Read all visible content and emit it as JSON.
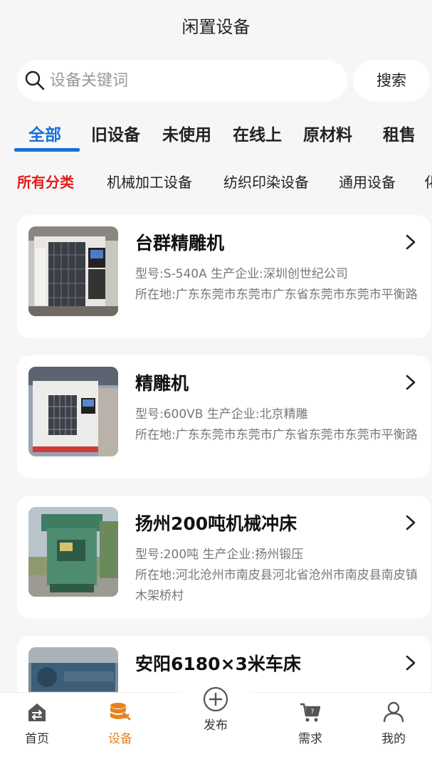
{
  "header": {
    "title": "闲置设备"
  },
  "search": {
    "placeholder": "设备关键词",
    "button_label": "搜索"
  },
  "tabs": [
    {
      "label": "全部",
      "active": true
    },
    {
      "label": "旧设备",
      "active": false
    },
    {
      "label": "未使用",
      "active": false
    },
    {
      "label": "在线上",
      "active": false
    },
    {
      "label": "原材料",
      "active": false
    },
    {
      "label": "租售",
      "active": false
    }
  ],
  "categories": [
    {
      "label": "所有分类",
      "active": true
    },
    {
      "label": "机械加工设备",
      "active": false
    },
    {
      "label": "纺织印染设备",
      "active": false
    },
    {
      "label": "通用设备",
      "active": false
    },
    {
      "label": "化",
      "active": false
    }
  ],
  "listings": [
    {
      "title": "台群精雕机",
      "meta": "型号:S-540A  生产企业:深圳创世纪公司",
      "location": "所在地:广东东莞市东莞市广东省东莞市东莞市平衡路"
    },
    {
      "title": "精雕机",
      "meta": "型号:600VB  生产企业:北京精雕",
      "location": "所在地:广东东莞市东莞市广东省东莞市东莞市平衡路"
    },
    {
      "title": "扬州200吨机械冲床",
      "meta": "型号:200吨  生产企业:扬州锻压",
      "location": "所在地:河北沧州市南皮县河北省沧州市南皮县南皮镇木架桥村"
    },
    {
      "title": "安阳6180×3米车床",
      "meta": "",
      "location": ""
    }
  ],
  "tabbar": {
    "home": "首页",
    "equipment": "设备",
    "publish": "发布",
    "demand": "需求",
    "mine": "我的"
  },
  "colors": {
    "accent": "#1a6fd8",
    "category_active": "#e41b1b",
    "tabbar_active": "#e8811f"
  }
}
